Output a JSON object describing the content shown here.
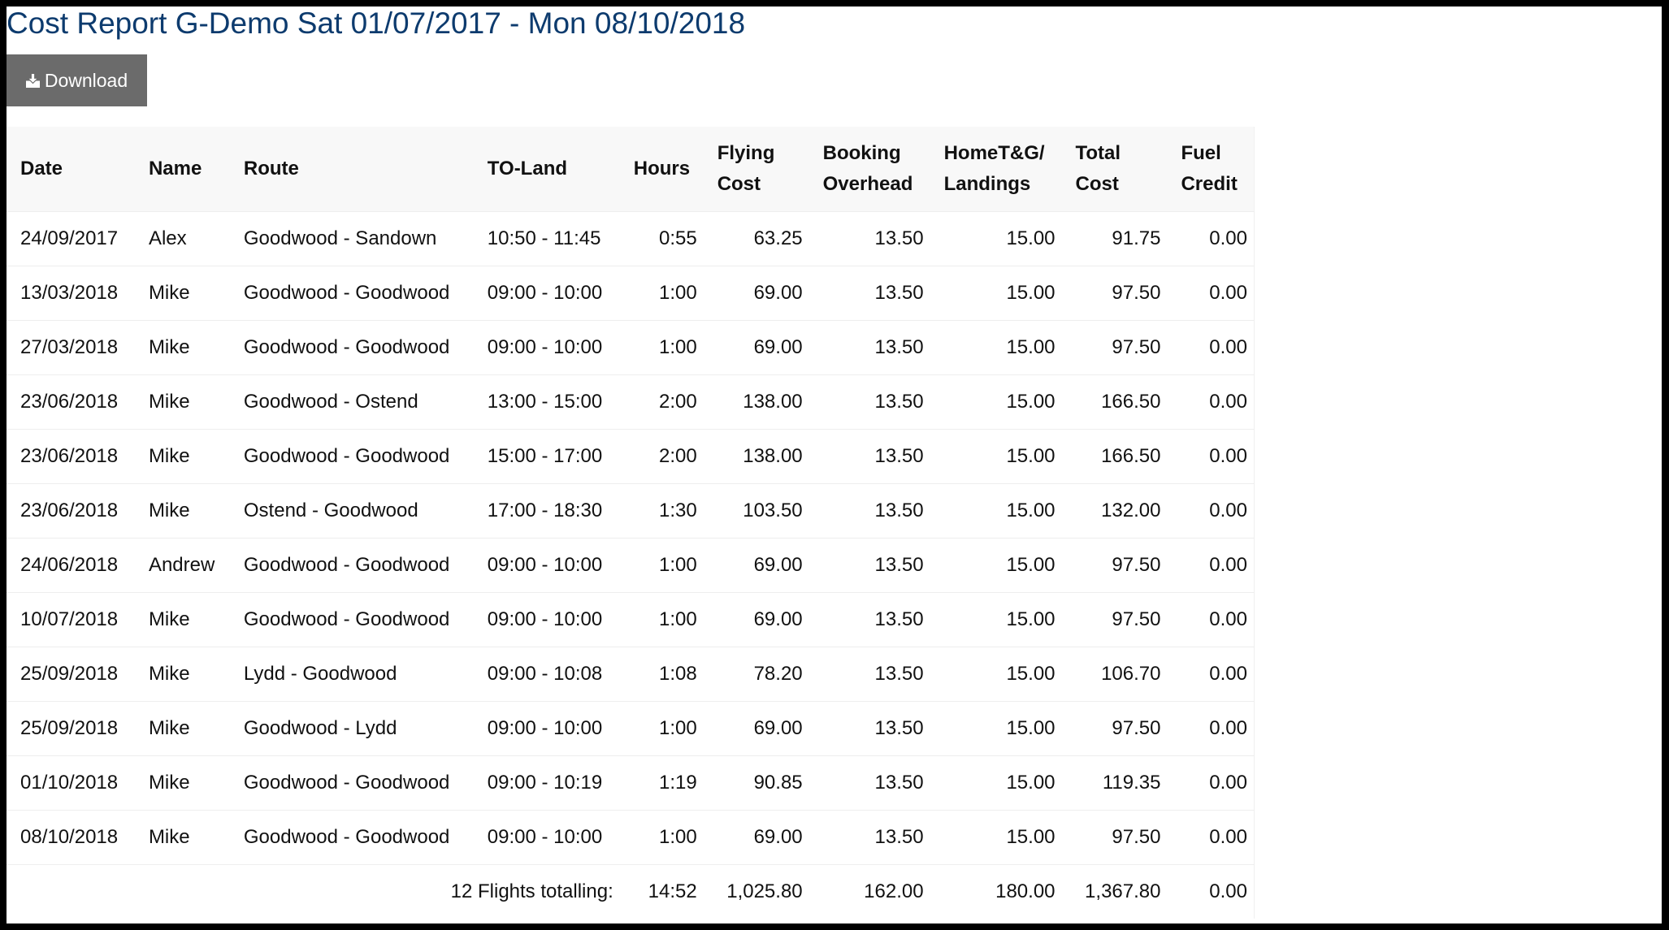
{
  "page": {
    "title": "Cost Report G-Demo Sat 01/07/2017 - Mon 08/10/2018",
    "download_label": "Download",
    "download_icon": "download-tray-icon",
    "colors": {
      "title": "#0d3b6e",
      "button_bg": "#6b6b6b",
      "header_bg": "#f8f8f8",
      "row_border": "#eeeeee"
    }
  },
  "table": {
    "headers": {
      "date": "Date",
      "name": "Name",
      "route": "Route",
      "to_land": "TO-Land",
      "hours": "Hours",
      "flying_cost_1": "Flying",
      "flying_cost_2": "Cost",
      "booking_overhead_1": "Booking",
      "booking_overhead_2": "Overhead",
      "home_tg_1": "HomeT&G/",
      "home_tg_2": "Landings",
      "total_cost_1": "Total",
      "total_cost_2": "Cost",
      "fuel_credit_1": "Fuel",
      "fuel_credit_2": "Credit"
    },
    "rows": [
      {
        "date": "24/09/2017",
        "name": "Alex",
        "route": "Goodwood - Sandown",
        "to_land": "10:50 - 11:45",
        "hours": "0:55",
        "flying_cost": "63.25",
        "booking_overhead": "13.50",
        "home_tg": "15.00",
        "total_cost": "91.75",
        "fuel_credit": "0.00"
      },
      {
        "date": "13/03/2018",
        "name": "Mike",
        "route": "Goodwood - Goodwood",
        "to_land": "09:00 - 10:00",
        "hours": "1:00",
        "flying_cost": "69.00",
        "booking_overhead": "13.50",
        "home_tg": "15.00",
        "total_cost": "97.50",
        "fuel_credit": "0.00"
      },
      {
        "date": "27/03/2018",
        "name": "Mike",
        "route": "Goodwood - Goodwood",
        "to_land": "09:00 - 10:00",
        "hours": "1:00",
        "flying_cost": "69.00",
        "booking_overhead": "13.50",
        "home_tg": "15.00",
        "total_cost": "97.50",
        "fuel_credit": "0.00"
      },
      {
        "date": "23/06/2018",
        "name": "Mike",
        "route": "Goodwood - Ostend",
        "to_land": "13:00 - 15:00",
        "hours": "2:00",
        "flying_cost": "138.00",
        "booking_overhead": "13.50",
        "home_tg": "15.00",
        "total_cost": "166.50",
        "fuel_credit": "0.00"
      },
      {
        "date": "23/06/2018",
        "name": "Mike",
        "route": "Goodwood - Goodwood",
        "to_land": "15:00 - 17:00",
        "hours": "2:00",
        "flying_cost": "138.00",
        "booking_overhead": "13.50",
        "home_tg": "15.00",
        "total_cost": "166.50",
        "fuel_credit": "0.00"
      },
      {
        "date": "23/06/2018",
        "name": "Mike",
        "route": "Ostend - Goodwood",
        "to_land": "17:00 - 18:30",
        "hours": "1:30",
        "flying_cost": "103.50",
        "booking_overhead": "13.50",
        "home_tg": "15.00",
        "total_cost": "132.00",
        "fuel_credit": "0.00"
      },
      {
        "date": "24/06/2018",
        "name": "Andrew",
        "route": "Goodwood - Goodwood",
        "to_land": "09:00 - 10:00",
        "hours": "1:00",
        "flying_cost": "69.00",
        "booking_overhead": "13.50",
        "home_tg": "15.00",
        "total_cost": "97.50",
        "fuel_credit": "0.00"
      },
      {
        "date": "10/07/2018",
        "name": "Mike",
        "route": "Goodwood - Goodwood",
        "to_land": "09:00 - 10:00",
        "hours": "1:00",
        "flying_cost": "69.00",
        "booking_overhead": "13.50",
        "home_tg": "15.00",
        "total_cost": "97.50",
        "fuel_credit": "0.00"
      },
      {
        "date": "25/09/2018",
        "name": "Mike",
        "route": "Lydd - Goodwood",
        "to_land": "09:00 - 10:08",
        "hours": "1:08",
        "flying_cost": "78.20",
        "booking_overhead": "13.50",
        "home_tg": "15.00",
        "total_cost": "106.70",
        "fuel_credit": "0.00"
      },
      {
        "date": "25/09/2018",
        "name": "Mike",
        "route": "Goodwood - Lydd",
        "to_land": "09:00 - 10:00",
        "hours": "1:00",
        "flying_cost": "69.00",
        "booking_overhead": "13.50",
        "home_tg": "15.00",
        "total_cost": "97.50",
        "fuel_credit": "0.00"
      },
      {
        "date": "01/10/2018",
        "name": "Mike",
        "route": "Goodwood - Goodwood",
        "to_land": "09:00 - 10:19",
        "hours": "1:19",
        "flying_cost": "90.85",
        "booking_overhead": "13.50",
        "home_tg": "15.00",
        "total_cost": "119.35",
        "fuel_credit": "0.00"
      },
      {
        "date": "08/10/2018",
        "name": "Mike",
        "route": "Goodwood - Goodwood",
        "to_land": "09:00 - 10:00",
        "hours": "1:00",
        "flying_cost": "69.00",
        "booking_overhead": "13.50",
        "home_tg": "15.00",
        "total_cost": "97.50",
        "fuel_credit": "0.00"
      }
    ],
    "totals": {
      "label": "12 Flights totalling:",
      "hours": "14:52",
      "flying_cost": "1,025.80",
      "booking_overhead": "162.00",
      "home_tg": "180.00",
      "total_cost": "1,367.80",
      "fuel_credit": "0.00"
    }
  }
}
